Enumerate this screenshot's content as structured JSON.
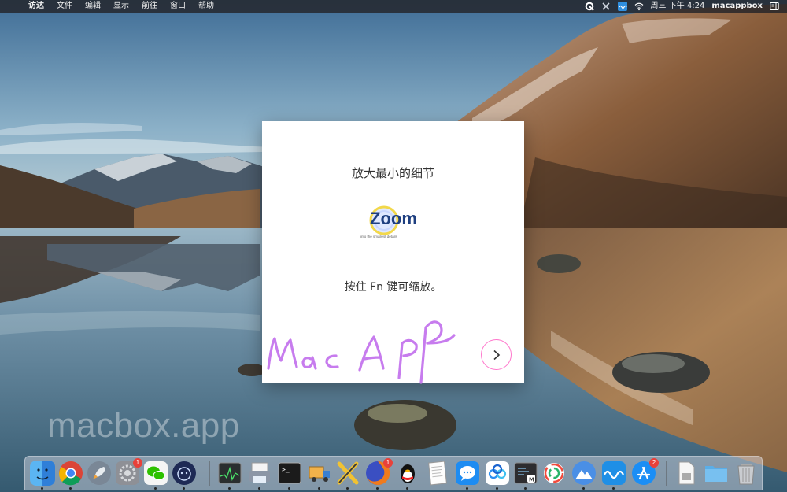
{
  "menubar": {
    "apple_glyph": "",
    "app_name": "访达",
    "menus": [
      "文件",
      "编辑",
      "显示",
      "前往",
      "窗口",
      "帮助"
    ],
    "datetime": "周三 下午 4:24",
    "username": "macappbox",
    "status_icons": [
      "loop-icon",
      "x-app-icon",
      "sound-wave-icon",
      "wifi-icon",
      "sidebar-icon"
    ]
  },
  "window": {
    "title": "放大最小的细节",
    "logo_text": "Zoom",
    "logo_subtitle": "into the smallest details",
    "hint": "按住 Fn 键可缩放。",
    "next_label": "›"
  },
  "signature": "MacApp",
  "watermark": "macbox.app",
  "dock": {
    "items": [
      {
        "name": "finder",
        "badge": ""
      },
      {
        "name": "chrome",
        "badge": ""
      },
      {
        "name": "launchpad",
        "badge": ""
      },
      {
        "name": "system-preferences",
        "badge": "1"
      },
      {
        "name": "wechat",
        "badge": ""
      },
      {
        "name": "pawmotion",
        "badge": ""
      },
      {
        "name": "activity-monitor",
        "badge": ""
      },
      {
        "name": "preview",
        "badge": ""
      },
      {
        "name": "terminal",
        "badge": ""
      },
      {
        "name": "transmit",
        "badge": ""
      },
      {
        "name": "x-app",
        "badge": ""
      },
      {
        "name": "firefox",
        "badge": "1"
      },
      {
        "name": "qq",
        "badge": ""
      },
      {
        "name": "textedit",
        "badge": ""
      },
      {
        "name": "messages",
        "badge": ""
      },
      {
        "name": "baidu-netdisk",
        "badge": ""
      },
      {
        "name": "codeeditor",
        "badge": ""
      },
      {
        "name": "mindnode",
        "badge": ""
      },
      {
        "name": "vpn",
        "badge": ""
      },
      {
        "name": "wave",
        "badge": ""
      },
      {
        "name": "app-store",
        "badge": "2"
      },
      {
        "name": "document",
        "badge": ""
      },
      {
        "name": "folder",
        "badge": ""
      },
      {
        "name": "trash",
        "badge": ""
      }
    ]
  },
  "colors": {
    "accent_pink": "#ff77cc",
    "signature_purple": "#c77cee",
    "badge_red": "#e8413a"
  }
}
